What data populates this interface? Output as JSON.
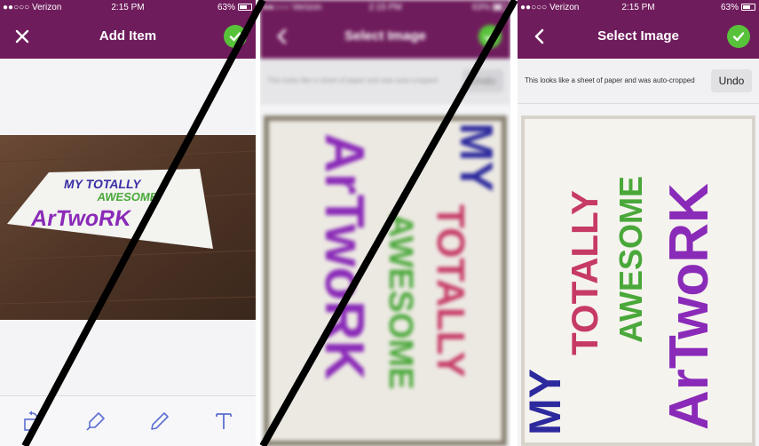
{
  "status_bar": {
    "carrier": "●●○○○ Verizon",
    "time": "2:15 PM",
    "battery": "63%"
  },
  "screens": [
    {
      "title": "Add Item",
      "left_icon": "close-icon",
      "right_icon": "check-icon",
      "photo_text": [
        "MY TOTALLY",
        "AWESOME",
        "ArTwoRK"
      ],
      "toolbar_icons": [
        "rotate-icon",
        "marker-icon",
        "pencil-icon",
        "text-icon"
      ]
    },
    {
      "title": "Select Image",
      "left_icon": "back-chevron-icon",
      "right_icon": "check-icon",
      "notice": "This looks like a sheet of paper and was auto-cropped",
      "undo_label": "Undo",
      "paper_text": [
        "MY",
        "TOTALLY",
        "AWESOME",
        "ArTwoRK"
      ]
    },
    {
      "title": "Select Image",
      "left_icon": "back-chevron-icon",
      "right_icon": "check-icon",
      "notice": "This looks like a sheet of paper and was auto-cropped",
      "undo_label": "Undo",
      "paper_text": [
        "MY",
        "TOTALLY",
        "AWESOME",
        "ArTwoRK"
      ]
    }
  ],
  "colors": {
    "nav_bar": "#6f1c5c",
    "confirm": "#58c23a",
    "text_red": "#d23a6a",
    "text_green": "#4aa83a",
    "text_blue": "#3a2fa6",
    "text_purple": "#8a2ab8"
  }
}
